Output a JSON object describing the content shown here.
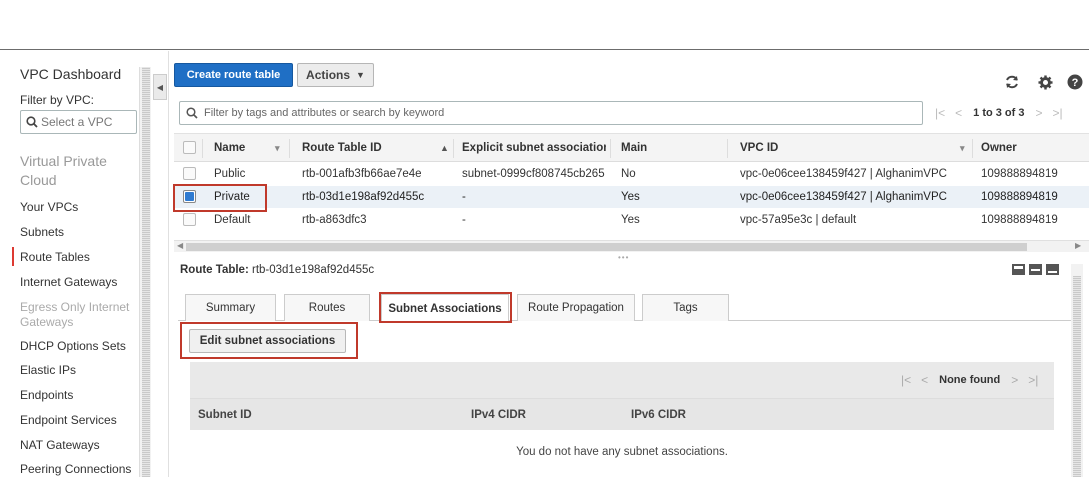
{
  "sidebar": {
    "title": "VPC Dashboard",
    "filter_label": "Filter by VPC:",
    "select_placeholder": "Select a VPC",
    "section": "Virtual Private Cloud",
    "items": [
      {
        "label": "Your VPCs"
      },
      {
        "label": "Subnets"
      },
      {
        "label": "Route Tables"
      },
      {
        "label": "Internet Gateways"
      },
      {
        "label": "Egress Only Internet Gateways"
      },
      {
        "label": "DHCP Options Sets"
      },
      {
        "label": "Elastic IPs"
      },
      {
        "label": "Endpoints"
      },
      {
        "label": "Endpoint Services"
      },
      {
        "label": "NAT Gateways"
      },
      {
        "label": "Peering Connections"
      }
    ]
  },
  "toolbar": {
    "create_label": "Create route table",
    "actions_label": "Actions",
    "icons": [
      "refresh-icon",
      "gear-icon",
      "help-icon"
    ]
  },
  "filter": {
    "placeholder": "Filter by tags and attributes or search by keyword",
    "pager_text": "1 to 3 of 3"
  },
  "table": {
    "columns": [
      "Name",
      "Route Table ID",
      "Explicit subnet association",
      "Main",
      "VPC ID",
      "Owner"
    ],
    "rows": [
      {
        "name": "Public",
        "id": "rtb-001afb3fb66ae7e4e",
        "explicit": "subnet-0999cf808745cb265",
        "main": "No",
        "vpc": "vpc-0e06cee138459f427 | AlghanimVPC",
        "owner": "109888894819",
        "selected": false
      },
      {
        "name": "Private",
        "id": "rtb-03d1e198af92d455c",
        "explicit": "-",
        "main": "Yes",
        "vpc": "vpc-0e06cee138459f427 | AlghanimVPC",
        "owner": "109888894819",
        "selected": true
      },
      {
        "name": "Default",
        "id": "rtb-a863dfc3",
        "explicit": "-",
        "main": "Yes",
        "vpc": "vpc-57a95e3c | default",
        "owner": "109888894819",
        "selected": false
      }
    ]
  },
  "detail": {
    "title_label": "Route Table:",
    "title_value": "rtb-03d1e198af92d455c",
    "tabs": [
      "Summary",
      "Routes",
      "Subnet Associations",
      "Route Propagation",
      "Tags"
    ],
    "active_tab": "Subnet Associations",
    "edit_label": "Edit subnet associations",
    "pager_text": "None found",
    "columns": [
      "Subnet ID",
      "IPv4 CIDR",
      "IPv6 CIDR"
    ],
    "empty_message": "You do not have any subnet associations."
  },
  "colors": {
    "primary": "#1f6fc5",
    "highlight": "#c0392b",
    "selected_row": "#ebf1f7"
  }
}
